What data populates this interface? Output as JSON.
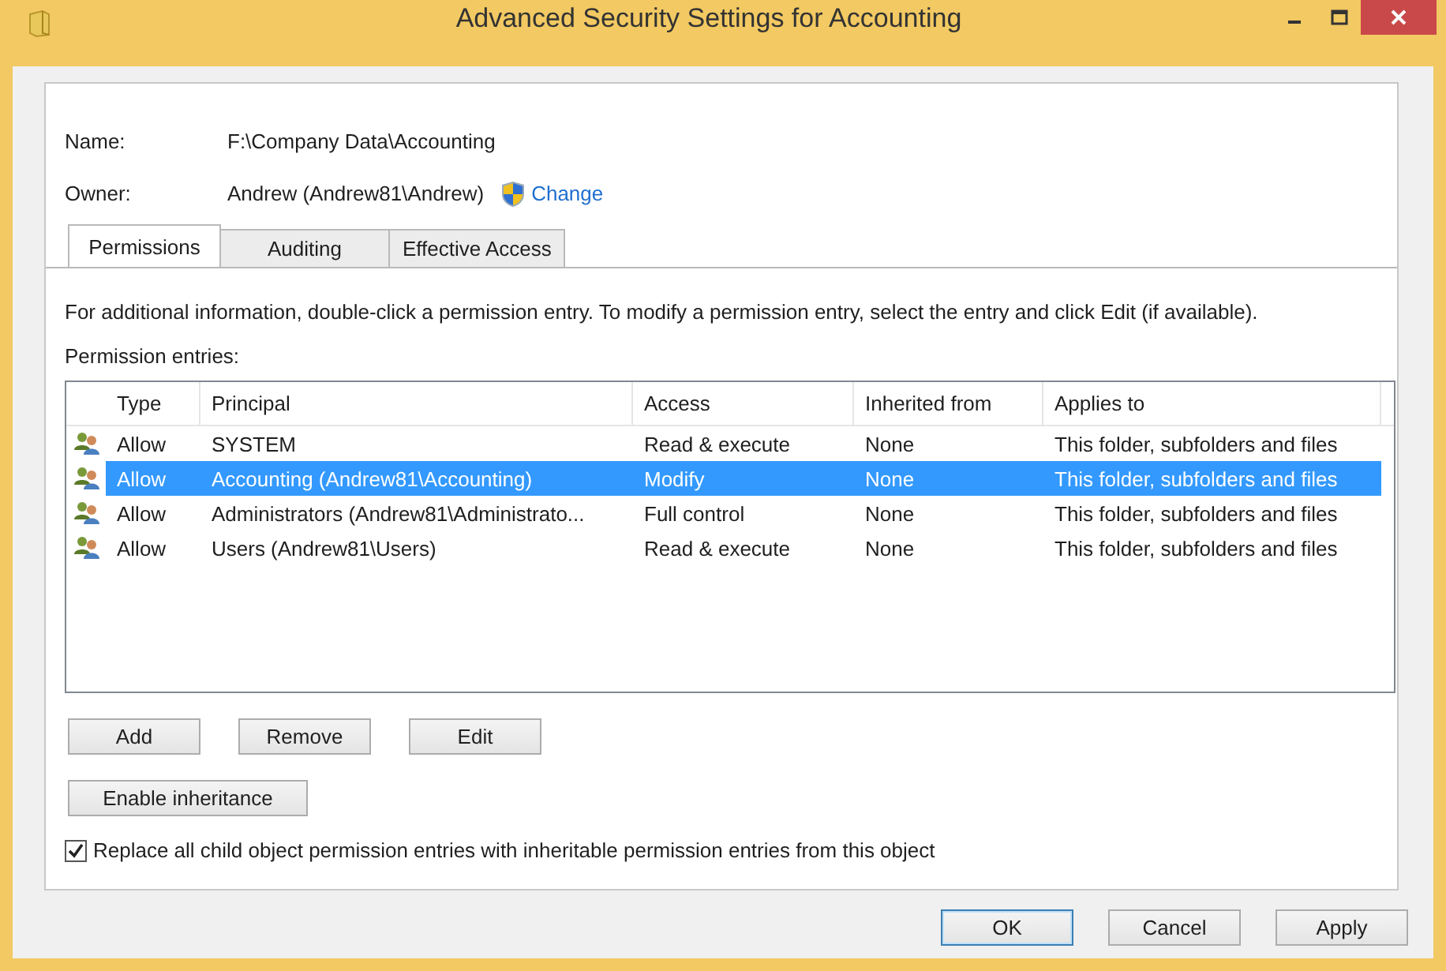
{
  "window": {
    "title": "Advanced Security Settings for Accounting"
  },
  "fields": [
    {
      "label": "Name:",
      "value": "F:\\Company Data\\Accounting"
    },
    {
      "label": "Owner:",
      "value": "Andrew (Andrew81\\Andrew)",
      "link": "Change"
    }
  ],
  "tabs": [
    {
      "label": "Permissions",
      "selected": true
    },
    {
      "label": "Auditing",
      "selected": false
    },
    {
      "label": "Effective Access",
      "selected": false
    }
  ],
  "instructions": "For additional information, double-click a permission entry. To modify a permission entry, select the entry and click Edit (if available).",
  "table": {
    "label": "Permission entries:",
    "columns": [
      "Type",
      "Principal",
      "Access",
      "Inherited from",
      "Applies to"
    ],
    "rows": [
      {
        "cells": [
          "Allow",
          "SYSTEM",
          "Read & execute",
          "None",
          "This folder, subfolders and files"
        ],
        "selected": false
      },
      {
        "cells": [
          "Allow",
          "Accounting (Andrew81\\Accounting)",
          "Modify",
          "None",
          "This folder, subfolders and files"
        ],
        "selected": true
      },
      {
        "cells": [
          "Allow",
          "Administrators (Andrew81\\Administrato...",
          "Full control",
          "None",
          "This folder, subfolders and files"
        ],
        "selected": false
      },
      {
        "cells": [
          "Allow",
          "Users (Andrew81\\Users)",
          "Read & execute",
          "None",
          "This folder, subfolders and files"
        ],
        "selected": false
      }
    ]
  },
  "entry_buttons": [
    "Add",
    "Remove",
    "Edit"
  ],
  "inheritance_button": "Enable inheritance",
  "replace_checkbox": {
    "label": "Replace all child object permission entries with inheritable permission entries from this object",
    "checked": true
  },
  "dialog_buttons": [
    {
      "label": "OK",
      "default": true
    },
    {
      "label": "Cancel",
      "default": false
    },
    {
      "label": "Apply",
      "default": false
    }
  ]
}
